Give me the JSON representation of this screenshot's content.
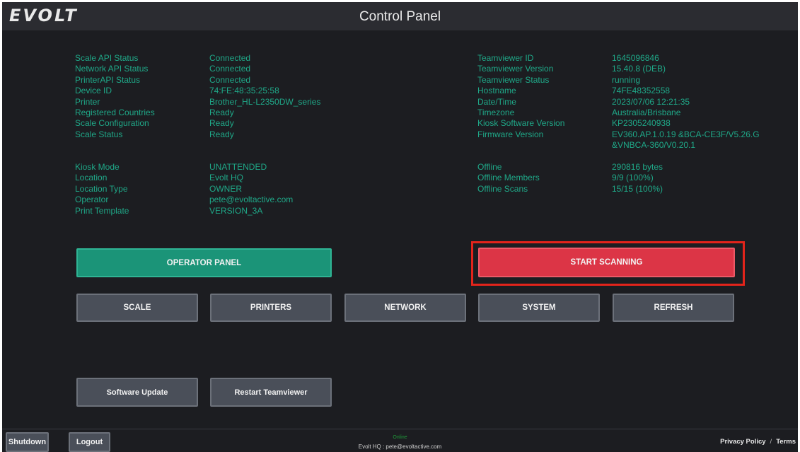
{
  "app": {
    "logo": "EVOLT",
    "title": "Control Panel"
  },
  "status_left_1": [
    {
      "label": "Scale API Status",
      "value": "Connected"
    },
    {
      "label": "Network API Status",
      "value": "Connected"
    },
    {
      "label": "PrinterAPI Status",
      "value": "Connected"
    },
    {
      "label": "Device ID",
      "value": "74:FE:48:35:25:58"
    },
    {
      "label": "Printer",
      "value": "Brother_HL-L2350DW_series"
    },
    {
      "label": "Registered Countries",
      "value": "Ready"
    },
    {
      "label": "Scale Configuration",
      "value": "Ready"
    },
    {
      "label": "Scale Status",
      "value": "Ready"
    }
  ],
  "status_left_2": [
    {
      "label": "Kiosk Mode",
      "value": "UNATTENDED"
    },
    {
      "label": "Location",
      "value": "Evolt HQ"
    },
    {
      "label": "Location Type",
      "value": "OWNER"
    },
    {
      "label": "Operator",
      "value": "pete@evoltactive.com"
    },
    {
      "label": "Print Template",
      "value": "VERSION_3A"
    }
  ],
  "status_right_1": [
    {
      "label": "Teamviewer ID",
      "value": "1645096846"
    },
    {
      "label": "Teamviewer Version",
      "value": "15.40.8 (DEB)"
    },
    {
      "label": "Teamviewer Status",
      "value": "running"
    },
    {
      "label": "Hostname",
      "value": "74FE48352558"
    },
    {
      "label": "Date/Time",
      "value": "2023/07/06 12:21:35"
    },
    {
      "label": "Timezone",
      "value": "Australia/Brisbane"
    },
    {
      "label": "Kiosk Software Version",
      "value": "KP2305240938"
    },
    {
      "label": "Firmware Version",
      "value": "EV360.AP.1.0.19 &BCA-CE3F/V5.26.G\n&VNBCA-360/V0.20.1"
    }
  ],
  "status_right_2": [
    {
      "label": "Offline",
      "value": "290816 bytes"
    },
    {
      "label": "Offline Members",
      "value": "9/9 (100%)"
    },
    {
      "label": "Offline Scans",
      "value": "15/15 (100%)"
    }
  ],
  "buttons": {
    "operator_panel": "OPERATOR PANEL",
    "start_scanning": "START SCANNING",
    "scale": "SCALE",
    "printers": "PRINTERS",
    "network": "NETWORK",
    "system": "SYSTEM",
    "refresh": "REFRESH",
    "software_update": "Software Update",
    "restart_teamviewer": "Restart Teamviewer"
  },
  "footer": {
    "shutdown": "Shutdown",
    "logout": "Logout",
    "connection_status": "Online",
    "location_operator": "Evolt HQ : pete@evoltactive.com",
    "privacy": "Privacy Policy",
    "separator": "/",
    "terms": "Terms"
  },
  "colors": {
    "text_accent": "#1fa888",
    "teal_button": "#1b9478",
    "red_button": "#dc3546",
    "highlight": "#e3241b",
    "background": "#1c1d21"
  }
}
